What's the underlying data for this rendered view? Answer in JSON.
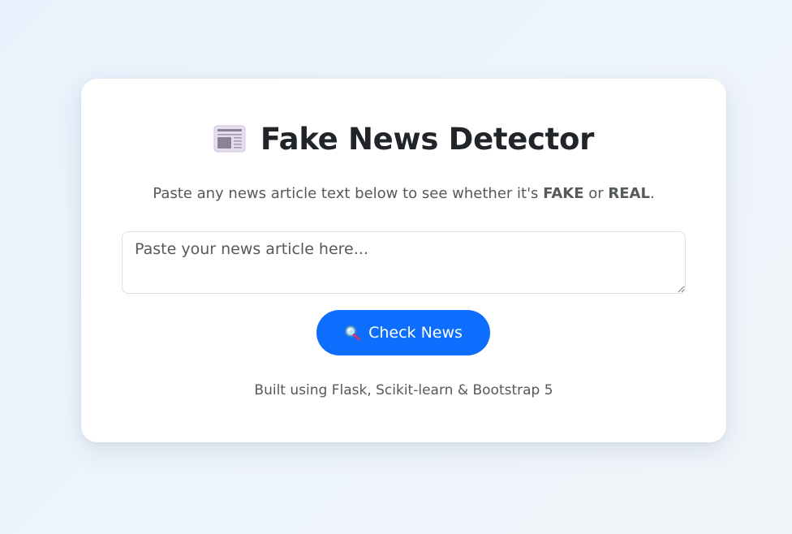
{
  "header": {
    "icon": "newspaper-icon",
    "title": "Fake News Detector"
  },
  "intro": {
    "text_before": "Paste any news article text below to see whether it's ",
    "fake_label": "FAKE",
    "text_middle": " or ",
    "real_label": "REAL",
    "text_after": "."
  },
  "article_input": {
    "placeholder": "Paste your news article here...",
    "value": ""
  },
  "check_button": {
    "icon": "magnifier-icon",
    "label": "Check News",
    "color": "#0d6efd"
  },
  "footer": {
    "text": "Built using Flask, Scikit-learn & Bootstrap 5"
  }
}
